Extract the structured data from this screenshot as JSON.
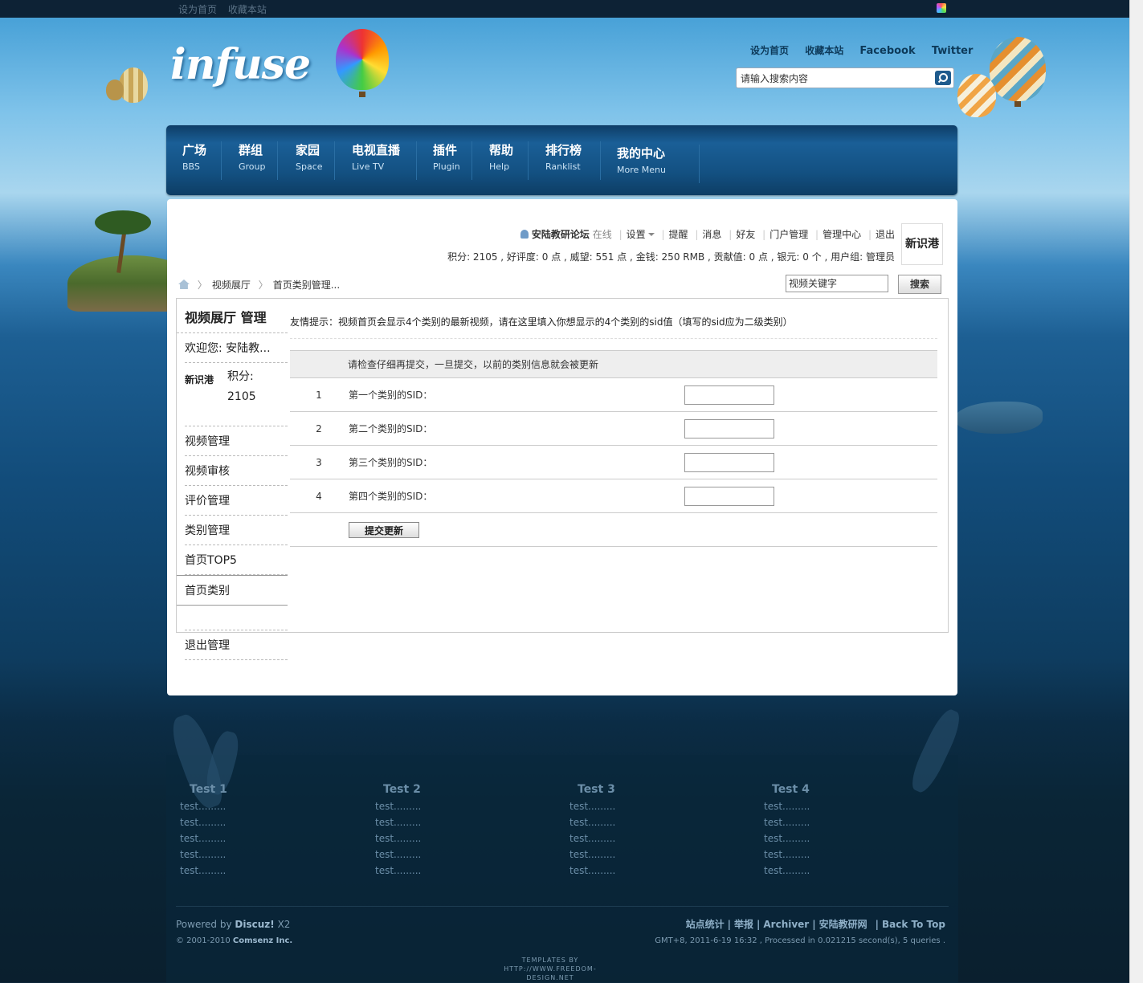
{
  "topbar": {
    "set_home": "设为首页",
    "bookmark": "收藏本站"
  },
  "header": {
    "logo": "infuse",
    "links": [
      "设为首页",
      "收藏本站",
      "Facebook",
      "Twitter"
    ],
    "search_placeholder": "请输入搜索内容"
  },
  "nav": [
    {
      "cn": "广场",
      "en": "BBS"
    },
    {
      "cn": "群组",
      "en": "Group"
    },
    {
      "cn": "家园",
      "en": "Space"
    },
    {
      "cn": "电视直播",
      "en": "Live TV"
    },
    {
      "cn": "插件",
      "en": "Plugin"
    },
    {
      "cn": "帮助",
      "en": "Help"
    },
    {
      "cn": "排行榜",
      "en": "Ranklist"
    },
    {
      "cn": "我的中心",
      "en": "More Menu"
    }
  ],
  "userbar": {
    "username": "安陆教研论坛",
    "status": "在线",
    "settings": "设置",
    "items": [
      "提醒",
      "消息",
      "好友",
      "门户管理",
      "管理中心",
      "退出"
    ],
    "credits": "积分: 2105 , 好评度: 0 点 , 威望: 551 点 , 金钱: 250 RMB , 贡献值: 0 点 , 银元: 0 个 , 用户组: 管理员",
    "avatar_text": "新识港"
  },
  "breadcrumb": {
    "items": [
      "视频展厅",
      "首页类别管理..."
    ]
  },
  "video_search": {
    "placeholder": "视频关键字",
    "button": "搜索"
  },
  "sidebar": {
    "title": "视频展厅  管理",
    "welcome": "欢迎您: 安陆教...",
    "points_label": "积分:",
    "points_value": "2105",
    "menu": [
      "视频管理",
      "视频审核",
      "评价管理",
      "类别管理",
      "首页TOP5"
    ],
    "active": "首页类别",
    "logout": "退出管理"
  },
  "main": {
    "tip": "友情提示：视频首页会显示4个类别的最新视频，请在这里填入你想显示的4个类别的sid值（填写的sid应为二级类别）",
    "table_header": "请检查仔细再提交，一旦提交，以前的类别信息就会被更新",
    "rows": [
      {
        "num": "1",
        "label": "第一个类别的SID：",
        "value": ""
      },
      {
        "num": "2",
        "label": "第二个类别的SID：",
        "value": ""
      },
      {
        "num": "3",
        "label": "第三个类别的SID：",
        "value": ""
      },
      {
        "num": "4",
        "label": "第四个类别的SID：",
        "value": ""
      }
    ],
    "submit": "提交更新"
  },
  "footer": {
    "columns": [
      {
        "title": "Test 1",
        "links": [
          "test.........",
          "test.........",
          "test.........",
          "test.........",
          "test........."
        ]
      },
      {
        "title": "Test 2",
        "links": [
          "test.........",
          "test.........",
          "test.........",
          "test.........",
          "test........."
        ]
      },
      {
        "title": "Test 3",
        "links": [
          "test.........",
          "test.........",
          "test.........",
          "test.........",
          "test........."
        ]
      },
      {
        "title": "Test 4",
        "links": [
          "test.........",
          "test.........",
          "test.........",
          "test.........",
          "test........."
        ]
      }
    ],
    "powered_prefix": "Powered by",
    "powered_name": "Discuz!",
    "powered_version": "X2",
    "copyright_prefix": "© 2001-2010",
    "copyright_company": "Comsenz Inc.",
    "links": [
      "站点统计",
      "举报",
      "Archiver",
      "安陆教研网",
      "Back To Top"
    ],
    "gmt": "GMT+8, 2011-6-19 16:32 , Processed in 0.021215 second(s), 5 queries .",
    "credit_line1": "TEMPLATES BY",
    "credit_line2": "HTTP://WWW.FREEDOM-DESIGN.NET"
  }
}
